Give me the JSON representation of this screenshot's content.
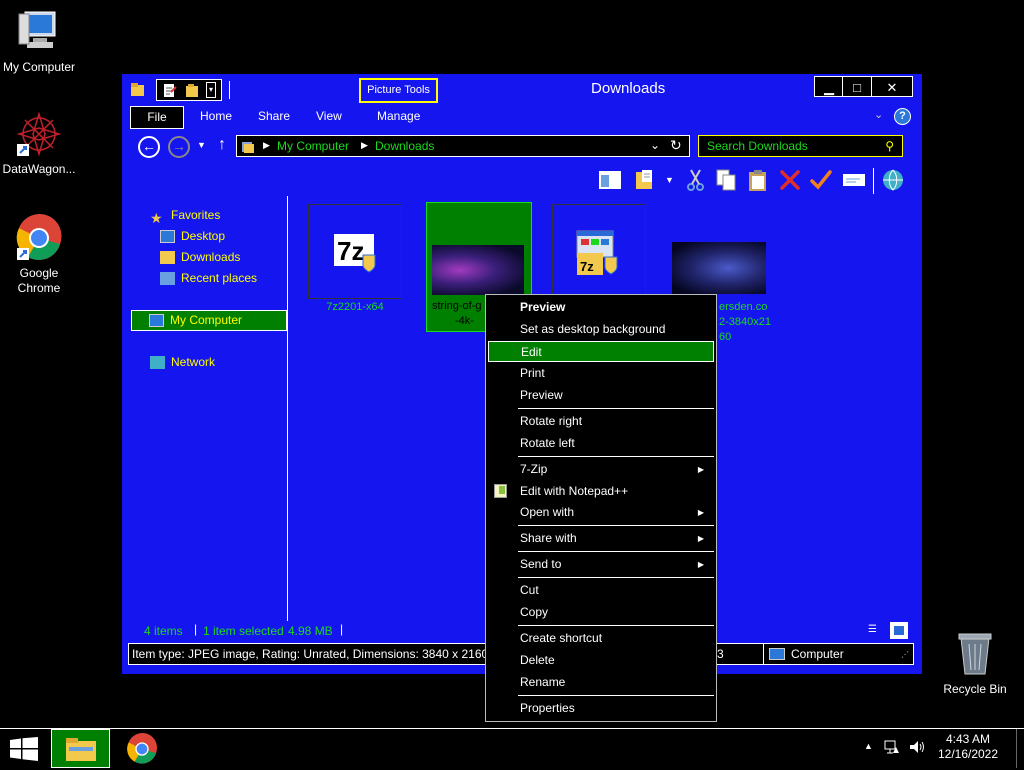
{
  "desktop": {
    "icons": [
      {
        "label": "My Computer"
      },
      {
        "label": "DataWagon..."
      },
      {
        "label": "Google\nChrome"
      },
      {
        "label": "Recycle Bin"
      }
    ]
  },
  "window": {
    "title": "Downloads",
    "picture_tools": "Picture Tools",
    "tabs": {
      "file": "File",
      "home": "Home",
      "share": "Share",
      "view": "View",
      "manage": "Manage"
    },
    "address": {
      "crumb1": "My Computer",
      "crumb2": "Downloads"
    },
    "search_placeholder": "Search Downloads",
    "nav_pane": {
      "favorites": "Favorites",
      "desktop": "Desktop",
      "downloads": "Downloads",
      "recent": "Recent places",
      "my_computer": "My Computer",
      "network": "Network"
    },
    "files": [
      {
        "name": "7z2201-x64"
      },
      {
        "name_line1": "string-of-g",
        "name_line2": "-4k-"
      },
      {
        "name": ""
      },
      {
        "name_line1": "ersden.co",
        "name_line2": "2-3840x21",
        "name_line3": "60"
      }
    ],
    "status": {
      "items": "4 items",
      "selected": "1 item selected",
      "size": "4.98 MB"
    },
    "details_bar": {
      "info": "Item type: JPEG image, Rating: Unrated, Dimensions: 3840 x 2160, Si",
      "fragment": "3",
      "location": "Computer"
    }
  },
  "context_menu": {
    "preview_bold": "Preview",
    "set_background": "Set as desktop background",
    "edit": "Edit",
    "print": "Print",
    "preview": "Preview",
    "rotate_right": "Rotate right",
    "rotate_left": "Rotate left",
    "zip": "7-Zip",
    "notepad": "Edit with Notepad++",
    "open_with": "Open with",
    "share_with": "Share with",
    "send_to": "Send to",
    "cut": "Cut",
    "copy": "Copy",
    "create_shortcut": "Create shortcut",
    "delete": "Delete",
    "rename": "Rename",
    "properties": "Properties"
  },
  "taskbar": {
    "time": "4:43 AM",
    "date": "12/16/2022"
  },
  "colors": {
    "window_frame": "#1515ef",
    "highlight": "#008000",
    "nav_text": "#ffff00",
    "accent_text": "#1bd91b"
  }
}
